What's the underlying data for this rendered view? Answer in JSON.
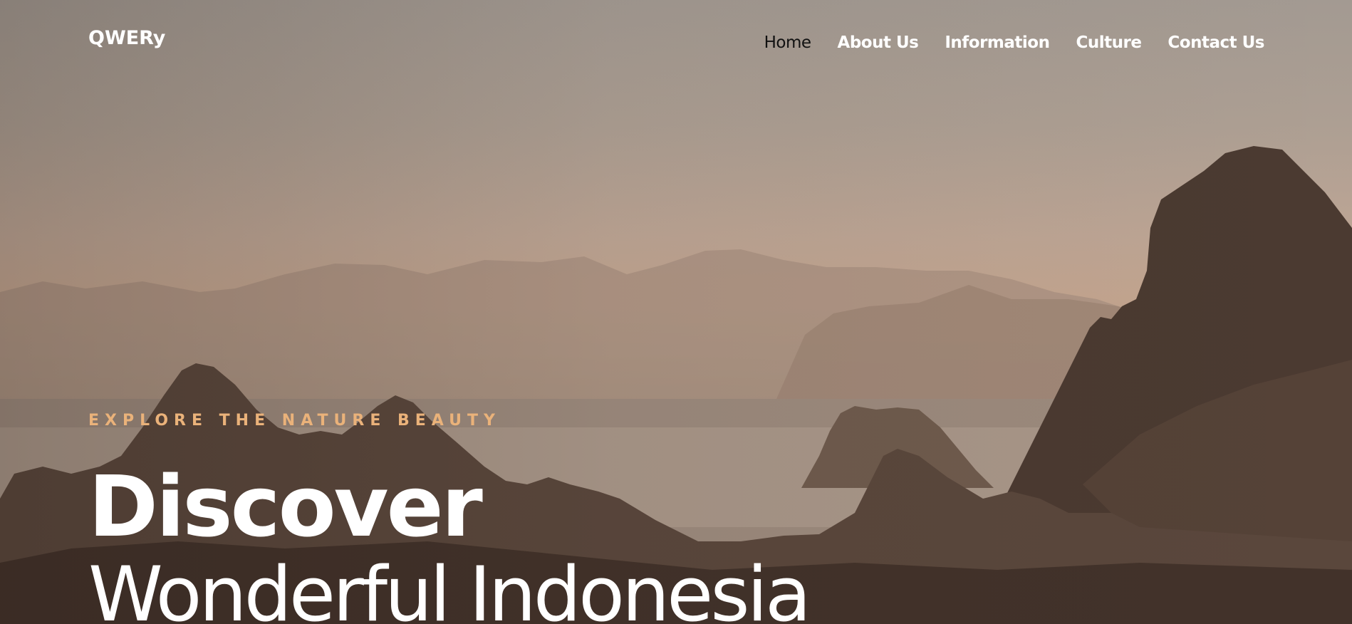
{
  "brand": {
    "logo_text": "QWERy"
  },
  "nav": {
    "items": [
      {
        "label": "Home",
        "active": true
      },
      {
        "label": "About Us",
        "active": false
      },
      {
        "label": "Information",
        "active": false
      },
      {
        "label": "Culture",
        "active": false
      },
      {
        "label": "Contact Us",
        "active": false
      }
    ]
  },
  "hero": {
    "kicker": "EXPLORE THE NATURE BEAUTY",
    "headline_bold": "Discover",
    "headline_light": "Wonderful Indonesia",
    "accent_color": "#eab27a",
    "background": "hazy mountain and sea landscape at dusk"
  }
}
